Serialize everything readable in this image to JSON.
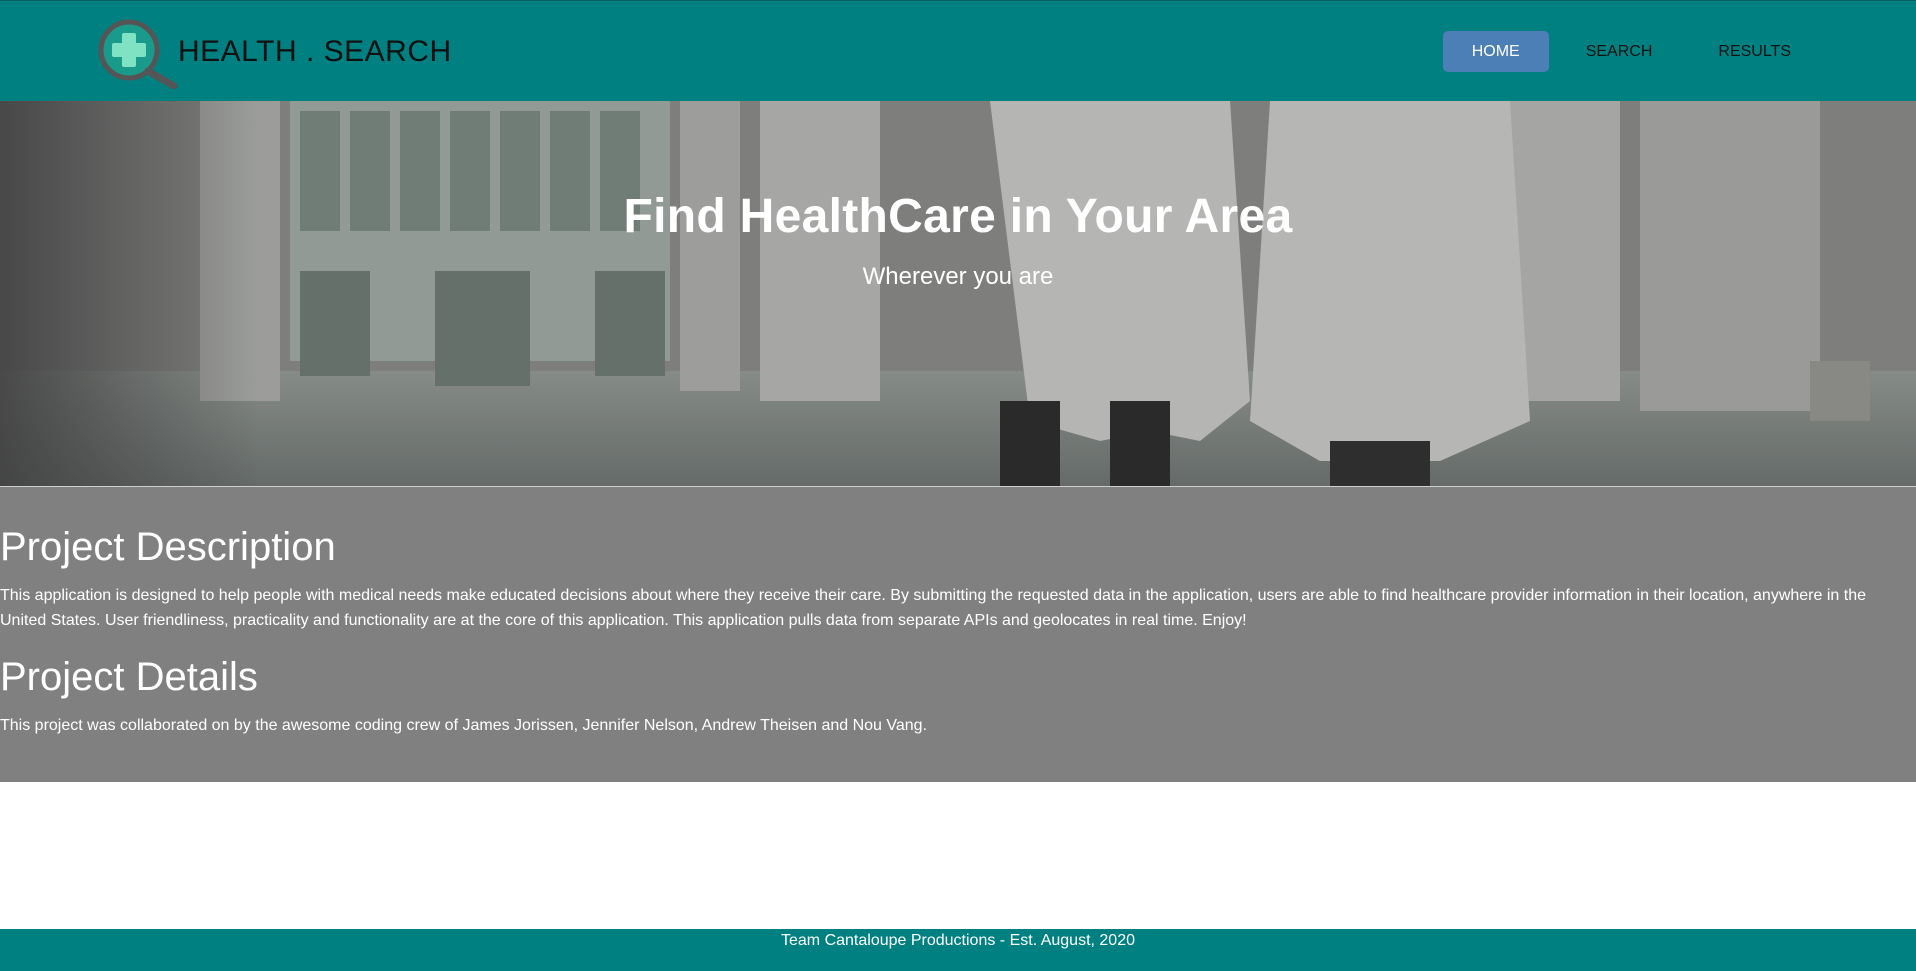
{
  "brand": {
    "name": "HEALTH . SEARCH",
    "logo_icon": "magnifier-medical-cross-icon"
  },
  "nav": {
    "items": [
      {
        "label": "HOME",
        "active": true
      },
      {
        "label": "SEARCH",
        "active": false
      },
      {
        "label": "RESULTS",
        "active": false
      }
    ]
  },
  "hero": {
    "title": "Find HealthCare in Your Area",
    "subtitle": "Wherever you are"
  },
  "about": {
    "description_heading": "Project Description",
    "description_text": "This application is designed to help people with medical needs make educated decisions about where they receive their care. By submitting the requested data in the application, users are able to find healthcare provider information in their location, anywhere in the United States. User friendliness, practicality and functionality are at the core of this application. This application pulls data from separate APIs and geolocates in real time. Enjoy!",
    "details_heading": "Project Details",
    "details_text": "This project was collaborated on by the awesome coding crew of James Jorissen, Jennifer Nelson, Andrew Theisen and Nou Vang."
  },
  "footer": {
    "text": "Team Cantaloupe Productions - Est. August, 2020"
  },
  "colors": {
    "navbar": "#008080",
    "active_nav": "#4b7fb6",
    "about_bg": "#808080",
    "footer": "#008080"
  }
}
